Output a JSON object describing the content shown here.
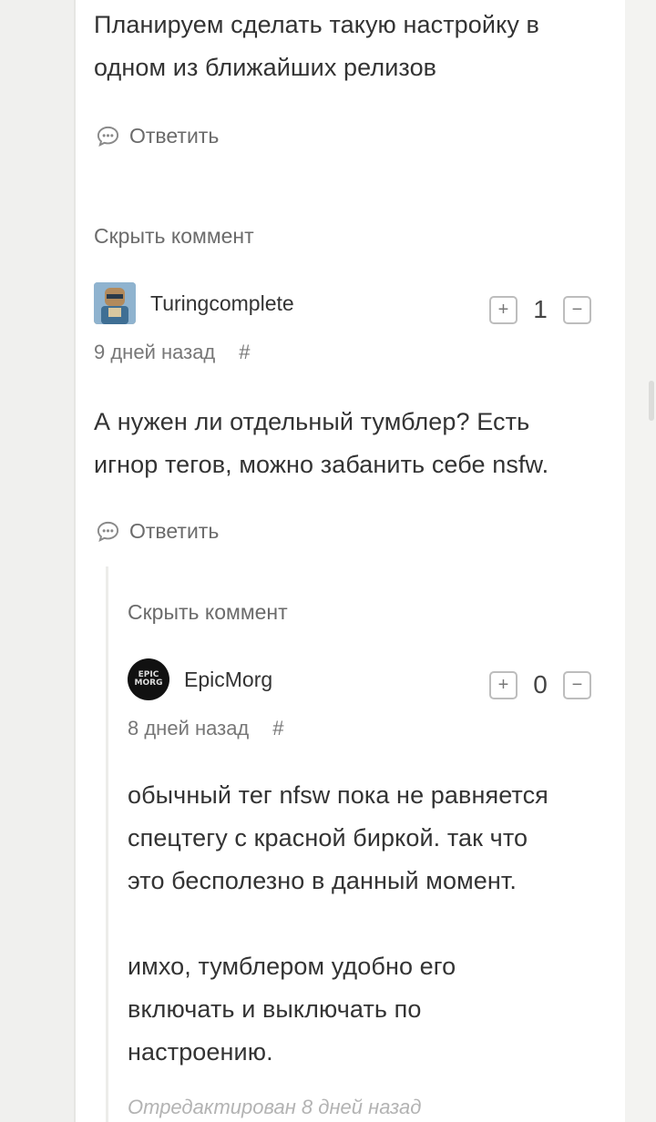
{
  "top_comment": {
    "text_line1": "Планируем сделать такую настройку в",
    "text_line2": "одном из ближайших релизов",
    "reply_label": "Ответить"
  },
  "comment1": {
    "hide_label": "Скрыть коммент",
    "author": "Turingcomplete",
    "vote_count": "1",
    "vote_plus": "+",
    "vote_minus": "−",
    "time": "9 дней назад",
    "hash": "#",
    "text_line1": "А нужен ли отдельный тумблер? Есть",
    "text_line2": "игнор тегов, можно забанить себе nsfw.",
    "reply_label": "Ответить"
  },
  "comment2": {
    "hide_label": "Скрыть коммент",
    "author": "EpicMorg",
    "avatar_text": "EPIC MORG",
    "vote_count": "0",
    "vote_plus": "+",
    "vote_minus": "−",
    "time": "8 дней назад",
    "hash": "#",
    "text_line1": "обычный тег nfsw пока не равняется",
    "text_line2": "спецтегу с красной биркой. так что",
    "text_line3": "это бесполезно в данный момент.",
    "text_line4": "имхо, тумблером удобно его",
    "text_line5": "включать и выключать по",
    "text_line6": "настроению.",
    "edited_label": "Отредактирован 8 дней назад"
  },
  "icons": {
    "reply": "speech-bubble-icon",
    "plus": "plus-icon",
    "minus": "minus-icon"
  },
  "colors": {
    "text": "#333333",
    "muted": "#6b6b6b",
    "edited": "#b3b3b3"
  }
}
